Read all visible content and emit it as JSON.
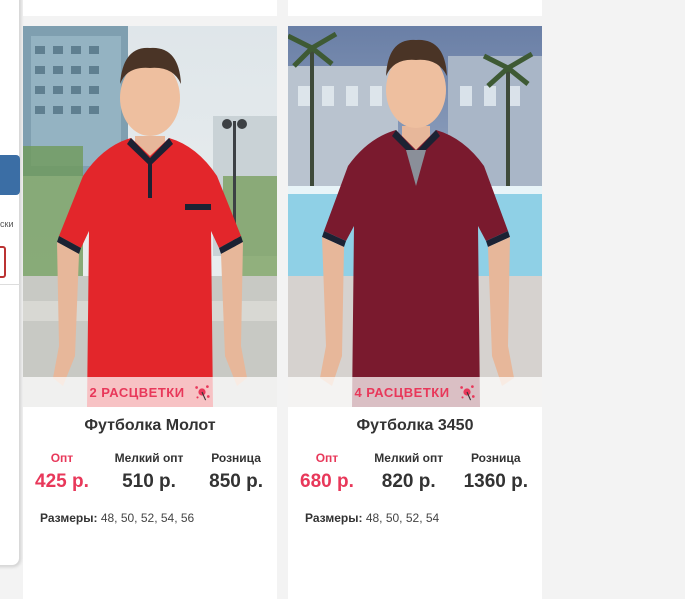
{
  "products": [
    {
      "colors_label": "2 РАСЦВЕТКИ",
      "name": "Футболка Молот",
      "price_opt_label": "Опт",
      "price_opt": "425 р.",
      "price_small_label": "Мелкий опт",
      "price_small": "510 р.",
      "price_retail_label": "Розница",
      "price_retail": "850 р.",
      "sizes_label": "Размеры:",
      "sizes": "48, 50, 52, 54, 56",
      "shirt_color": "#e3262b"
    },
    {
      "colors_label": "4 РАСЦВЕТКИ",
      "name": "Футболка 3450",
      "price_opt_label": "Опт",
      "price_opt": "680 р.",
      "price_small_label": "Мелкий опт",
      "price_small": "820 р.",
      "price_retail_label": "Розница",
      "price_retail": "1360 р.",
      "sizes_label": "Размеры:",
      "sizes": "48, 50, 52, 54",
      "shirt_color": "#7a1a2e"
    }
  ],
  "sidebar": {
    "text": "ски"
  },
  "accent_color": "#e8385a"
}
